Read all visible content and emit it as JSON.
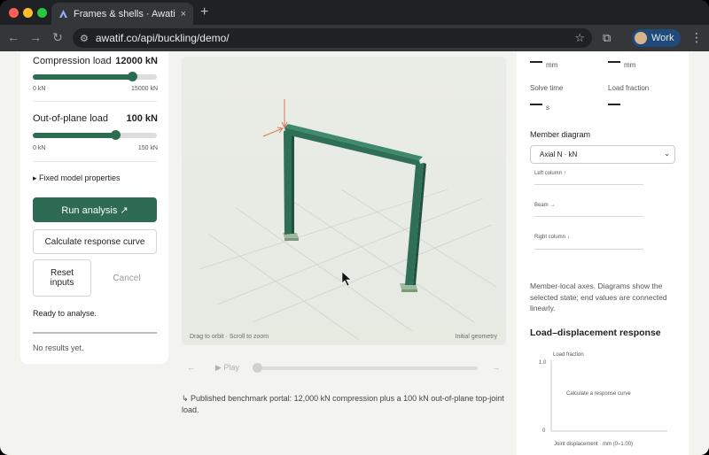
{
  "browser": {
    "tab_title": "Frames & shells · Awatif Buck",
    "tab_close": "×",
    "new_tab": "+",
    "url": "awatif.co/api/buckling/demo/",
    "profile_name": "Work"
  },
  "controls": {
    "compression": {
      "label": "Compression load",
      "value": "12000 kN",
      "min": "0 kN",
      "max": "15000 kN",
      "fraction": 0.8
    },
    "out_of_plane": {
      "label": "Out-of-plane load",
      "value": "100 kN",
      "min": "0 kN",
      "max": "150 kN",
      "fraction": 0.667
    },
    "fixed_props": "▸ Fixed model properties",
    "run_label": "Run analysis ↗",
    "curve_label": "Calculate response curve",
    "reset_label": "Reset inputs",
    "cancel_label": "Cancel",
    "status": "Ready to analyse.",
    "results": "No results yet."
  },
  "viewport": {
    "hint_left": "Drag to orbit · Scroll to zoom",
    "hint_right": "Initial geometry"
  },
  "playback": {
    "prev": "←",
    "play": "▶ Play",
    "next": "→",
    "progress": 0.0
  },
  "caption": "↳ Published benchmark portal: 12,000 kN compression plus a 100 kN out-of-plane top-joint load.",
  "results_panel": {
    "unit_mm": "mm",
    "unit_mm2": "mm",
    "solve_time_label": "Solve time",
    "load_fraction_label": "Load fraction",
    "unit_s": "s",
    "member_diagram_title": "Member diagram",
    "member_diagram_selected": "Axial N · kN",
    "diagram_rows": [
      "Left column ↑",
      "Beam →",
      "Right column ↓"
    ],
    "note": "Member-local axes. Diagrams show the selected state; end values are connected linearly.",
    "response_title": "Load–displacement response"
  },
  "chart_data": {
    "type": "line",
    "ylabel": "Load fraction",
    "xlabel": "Joint displacement · mm (0–1.00)",
    "ylim": [
      0,
      1.0
    ],
    "y_ticks": [
      "1.0",
      "0"
    ],
    "placeholder": "Calculate a response curve",
    "series": []
  },
  "colors": {
    "accent": "#2e6b53",
    "frame": "#2f6f55"
  }
}
